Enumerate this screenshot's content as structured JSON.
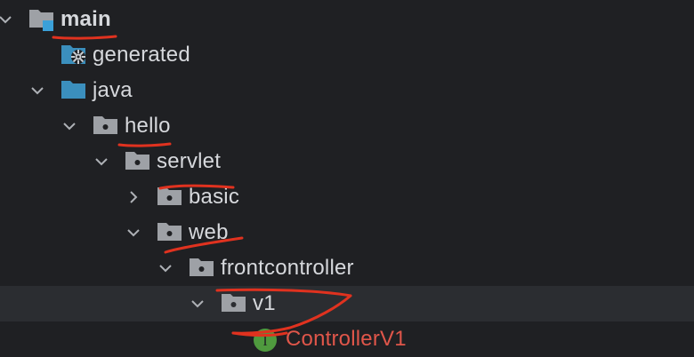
{
  "project_tree": {
    "main": {
      "label": "main"
    },
    "generated": {
      "label": "generated"
    },
    "java": {
      "label": "java"
    },
    "hello": {
      "label": "hello"
    },
    "servlet": {
      "label": "servlet"
    },
    "basic": {
      "label": "basic"
    },
    "web": {
      "label": "web"
    },
    "frontcontroller": {
      "label": "frontcontroller"
    },
    "v1": {
      "label": "v1"
    },
    "controller_v1": {
      "label": "ControllerV1",
      "badge": "I"
    }
  },
  "colors": {
    "background": "#1f2023",
    "selected_row": "#2b2d31",
    "folder_gray": "#9ea1a6",
    "folder_blue": "#3b8fbd",
    "error_text": "#e0564a",
    "interface_badge": "#4f9a3e",
    "annotation": "#e0321f"
  },
  "icons": {
    "chevron_open": "chevron-down-icon",
    "chevron_closed": "chevron-right-icon",
    "module_folder": "module-folder-icon",
    "generated_folder": "generated-sources-folder-icon",
    "source_folder": "source-root-folder-icon",
    "package": "package-folder-icon",
    "interface": "interface-icon"
  }
}
